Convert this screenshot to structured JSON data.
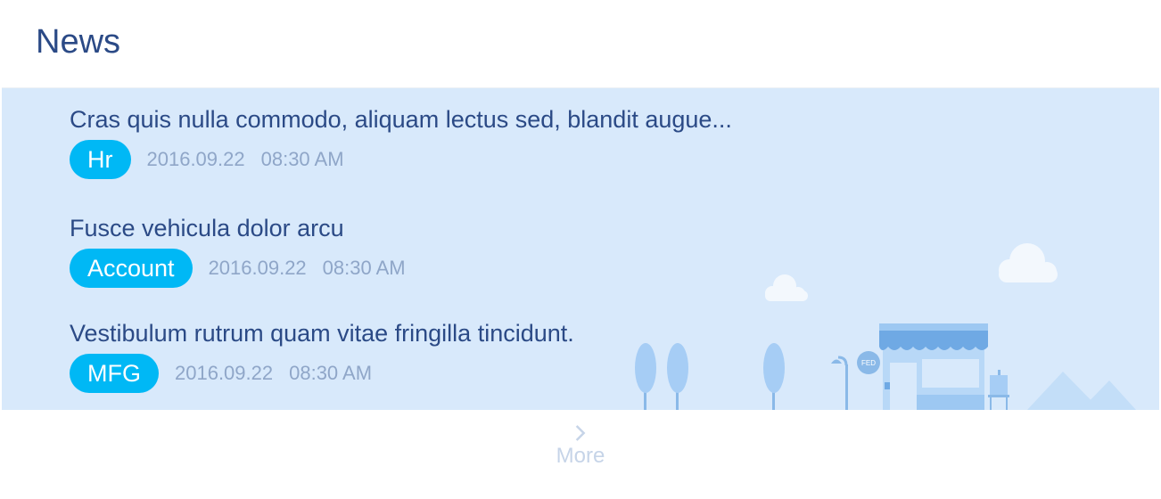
{
  "header": {
    "title": "News"
  },
  "news": [
    {
      "title": "Cras quis nulla commodo, aliquam lectus sed, blandit augue...",
      "tag": "Hr",
      "date": "2016.09.22",
      "time": "08:30 AM"
    },
    {
      "title": "Fusce vehicula dolor arcu",
      "tag": "Account",
      "date": "2016.09.22",
      "time": "08:30 AM"
    },
    {
      "title": "Vestibulum rutrum quam vitae fringilla tincidunt.",
      "tag": "MFG",
      "date": "2016.09.22",
      "time": "08:30 AM"
    }
  ],
  "illustration": {
    "sign_text": "FED"
  },
  "footer": {
    "more_label": "More",
    "more_icon": "chevron-right-icon"
  },
  "colors": {
    "title": "#2b4a86",
    "tag_background": "#00b8f5",
    "list_background": "#d8e9fb",
    "meta_text": "#8fa6c8",
    "more_text": "#c6d4e8"
  }
}
